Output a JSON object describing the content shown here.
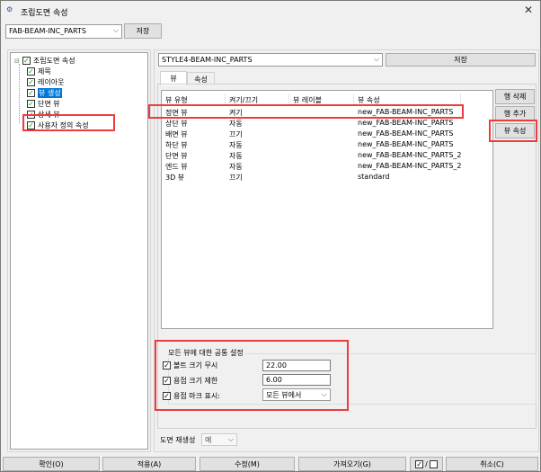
{
  "window": {
    "title": "조립도면 속성",
    "close": "✕"
  },
  "top": {
    "combo_value": "FAB-BEAM-INC_PARTS",
    "save": "저장"
  },
  "tree": {
    "root": "조립도면 속성",
    "items": [
      "제목",
      "레이아웃",
      "뷰 생성",
      "단면 뷰",
      "상세 뷰",
      "사용자 정의 속성"
    ],
    "selected": "뷰 생성"
  },
  "right": {
    "style_value": "STYLE4-BEAM-INC_PARTS",
    "save": "저장",
    "tabs": [
      "뷰",
      "속성"
    ],
    "columns": [
      "뷰 유형",
      "켜기/끄기",
      "뷰 레이블",
      "뷰 속성"
    ],
    "rows": [
      [
        "정면 뷰",
        "켜기",
        "",
        "new_FAB-BEAM-INC_PARTS"
      ],
      [
        "상단 뷰",
        "자동",
        "",
        "new_FAB-BEAM-INC_PARTS"
      ],
      [
        "배면 뷰",
        "끄기",
        "",
        "new_FAB-BEAM-INC_PARTS"
      ],
      [
        "하단 뷰",
        "자동",
        "",
        "new_FAB-BEAM-INC_PARTS"
      ],
      [
        "단면 뷰",
        "자동",
        "",
        "new_FAB-BEAM-INC_PARTS_2"
      ],
      [
        "엔드 뷰",
        "자동",
        "",
        "new_FAB-BEAM-INC_PARTS_2"
      ],
      [
        "3D 뷰",
        "끄기",
        "",
        "standard"
      ]
    ],
    "side_buttons": [
      "행 삭제",
      "행 추가",
      "뷰 속성"
    ],
    "group": {
      "legend": "모든 뷰에 대한 공통 설정",
      "bolt_label": "볼트 크기 무시",
      "bolt_value": "22.00",
      "weld_label": "용접 크기 제한",
      "weld_value": "6.00",
      "mark_label": "용접 마크 표시:",
      "mark_value": "모든 뷰에서"
    },
    "regen_label": "도면 재생성",
    "regen_value": "예"
  },
  "bottom": {
    "ok": "확인(O)",
    "apply": "적용(A)",
    "modify": "수정(M)",
    "get": "가져오기(G)",
    "toggle_sep": "/",
    "cancel": "취소(C)"
  }
}
